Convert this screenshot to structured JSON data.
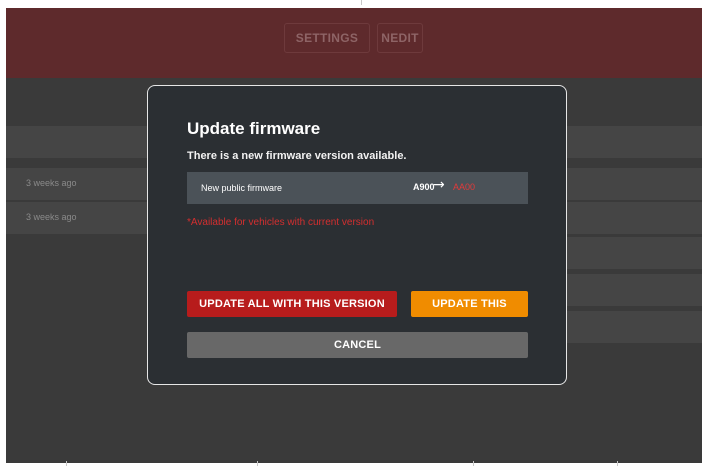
{
  "header": {
    "settings_label": "SETTINGS",
    "edit_label": "NEDIT"
  },
  "background_rows": [
    {
      "time": ""
    },
    {
      "time": "3 weeks ago"
    },
    {
      "time": "3 weeks ago"
    }
  ],
  "modal": {
    "title": "Update firmware",
    "subtitle": "There is a new firmware version available.",
    "firmware": {
      "label": "New public firmware",
      "current_version": "A900",
      "arrow": "→",
      "new_version": "AA00"
    },
    "note": "*Available for vehicles with current version",
    "buttons": {
      "update_all": "UPDATE ALL WITH THIS VERSION",
      "update_this": "UPDATE THIS",
      "cancel": "CANCEL"
    }
  },
  "colors": {
    "header_bg": "#5e2a2c",
    "modal_bg": "#2b2f33",
    "danger": "#b71c1c",
    "warning": "#f08c00",
    "neutral": "#686868",
    "new_version": "#e23a3a"
  }
}
